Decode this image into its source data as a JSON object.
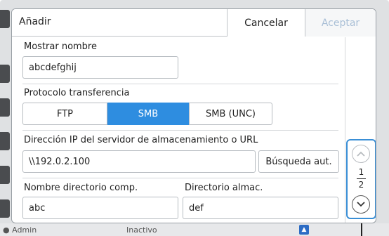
{
  "dialog": {
    "title": "Añadir",
    "cancel_label": "Cancelar",
    "accept_label": "Aceptar"
  },
  "display_name": {
    "label": "Mostrar nombre",
    "value": "abcdefghij"
  },
  "protocol": {
    "label": "Protocolo transferencia",
    "options": [
      "FTP",
      "SMB",
      "SMB (UNC)"
    ],
    "selected": "SMB"
  },
  "server": {
    "label": "Dirección IP del servidor de almacenamiento o URL",
    "value": "\\\\192.0.2.100",
    "search_button": "Búsqueda aut."
  },
  "shared_dir": {
    "label": "Nombre directorio comp.",
    "value": "abc"
  },
  "storage_dir": {
    "label": "Directorio almac.",
    "value": "def"
  },
  "pager": {
    "current": "1",
    "total": "2"
  },
  "background": {
    "user": "Admin",
    "status": "Inactivo"
  },
  "colors": {
    "accent": "#2e8de0",
    "highlight": "#3a8fd6"
  }
}
